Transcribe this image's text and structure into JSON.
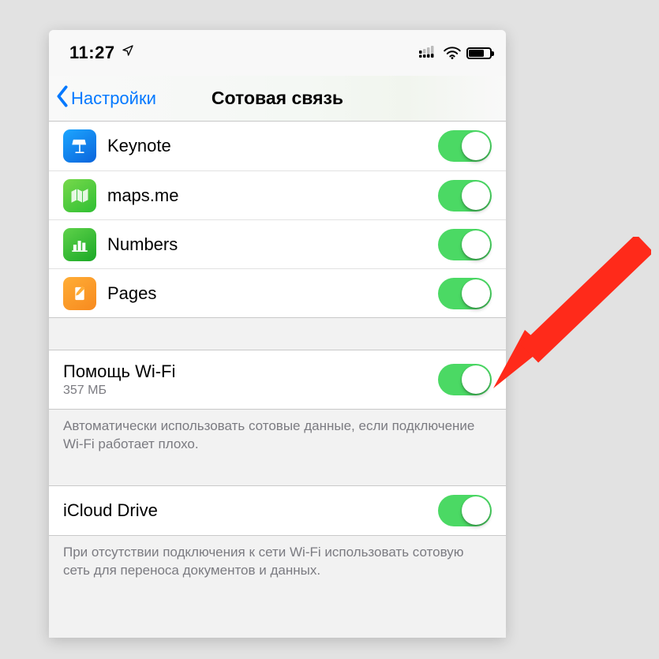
{
  "statusbar": {
    "time": "11:27",
    "location_icon": "◤",
    "battery_pct": 72
  },
  "nav": {
    "back_label": "Настройки",
    "title": "Сотовая связь"
  },
  "apps": [
    {
      "icon": "keynote",
      "label": "Keynote",
      "enabled": true
    },
    {
      "icon": "maps",
      "label": "maps.me",
      "enabled": true
    },
    {
      "icon": "numbers",
      "label": "Numbers",
      "enabled": true
    },
    {
      "icon": "pages",
      "label": "Pages",
      "enabled": true
    }
  ],
  "wifi_assist": {
    "title": "Помощь Wi-Fi",
    "usage": "357 МБ",
    "enabled": true,
    "footer": "Автоматически использовать сотовые данные, если подключение Wi-Fi работает плохо."
  },
  "icloud_drive": {
    "title": "iCloud Drive",
    "enabled": true,
    "footer": "При отсутствии подключения к сети Wi-Fi использовать сотовую сеть для переноса документов и данных."
  },
  "colors": {
    "switch_on": "#4bd964",
    "link_blue": "#0479ff",
    "arrow_red": "#ff2a1a"
  }
}
